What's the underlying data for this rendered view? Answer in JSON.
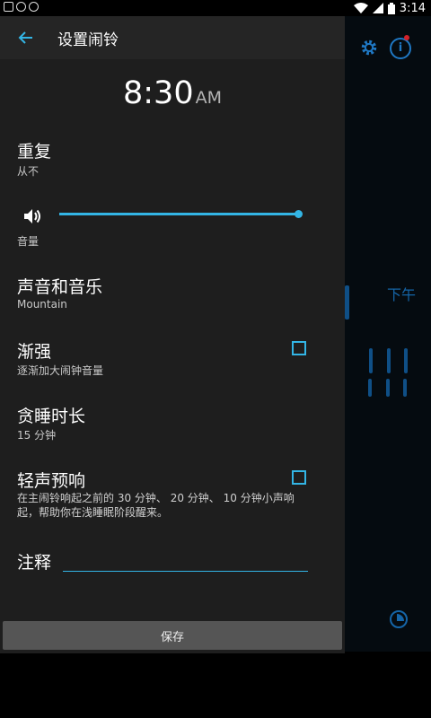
{
  "status_bar": {
    "time": "3:14",
    "icons": [
      "gallery-icon",
      "android-icon",
      "shield-icon",
      "wifi-icon",
      "signal-icon",
      "battery-icon"
    ]
  },
  "background_app": {
    "period": "下午",
    "icons": [
      "gear-icon",
      "info-icon",
      "timer-icon"
    ]
  },
  "dialog": {
    "title": "设置闹铃",
    "time": "8:30",
    "ampm": "AM",
    "repeat": {
      "label": "重复",
      "value": "从不"
    },
    "volume": {
      "label": "音量",
      "level": 1.0
    },
    "sound": {
      "label": "声音和音乐",
      "value": "Mountain"
    },
    "crescendo": {
      "label": "渐强",
      "description": "逐渐加大闹钟音量",
      "checked": false
    },
    "snooze": {
      "label": "贪睡时长",
      "value": "15 分钟"
    },
    "pre_alarm": {
      "label": "轻声预响",
      "description": "在主闹铃响起之前的 30 分钟、 20 分钟、 10 分钟小声响起，帮助你在浅睡眠阶段醒来。",
      "checked": false
    },
    "note": {
      "label": "注释",
      "value": ""
    },
    "save_label": "保存"
  },
  "colors": {
    "accent": "#33b5e5",
    "dialog_bg": "#1e1e1e",
    "action_bar": "#252525",
    "save_button": "#555555"
  }
}
